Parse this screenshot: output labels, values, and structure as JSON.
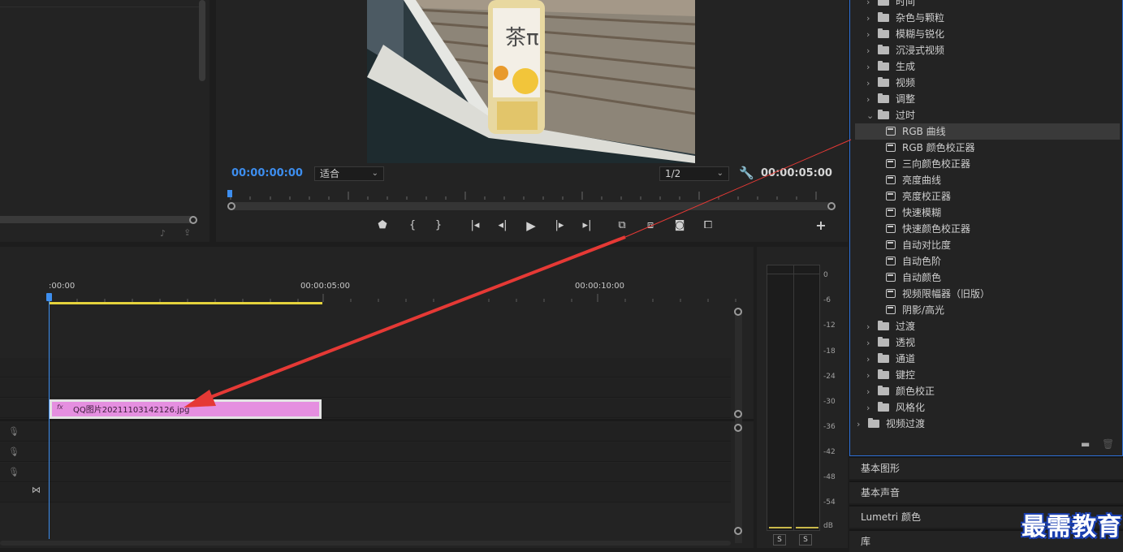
{
  "monitor": {
    "timecode_current": "00:00:00:00",
    "timecode_duration": "00:00:05:00",
    "fit_select": "适合",
    "resolution_select": "1/2",
    "video_label_text": "茶π"
  },
  "timeline": {
    "ruler_labels": [
      ":00:00",
      "00:00:05:00",
      "00:00:10:00"
    ],
    "clip": {
      "name": "QQ图片20211103142126.jpg",
      "badge": "fx"
    }
  },
  "meter": {
    "labels": [
      "0",
      "-6",
      "-12",
      "-18",
      "-24",
      "-30",
      "-36",
      "-42",
      "-48",
      "-54",
      "dB"
    ],
    "solo_buttons": [
      "S",
      "S"
    ]
  },
  "effects": {
    "tree": [
      {
        "label": "时间",
        "type": "folder",
        "level": 1,
        "expanded": false
      },
      {
        "label": "杂色与颗粒",
        "type": "folder",
        "level": 1,
        "expanded": false
      },
      {
        "label": "模糊与锐化",
        "type": "folder",
        "level": 1,
        "expanded": false
      },
      {
        "label": "沉浸式视频",
        "type": "folder",
        "level": 1,
        "expanded": false
      },
      {
        "label": "生成",
        "type": "folder",
        "level": 1,
        "expanded": false
      },
      {
        "label": "视频",
        "type": "folder",
        "level": 1,
        "expanded": false
      },
      {
        "label": "调整",
        "type": "folder",
        "level": 1,
        "expanded": false
      },
      {
        "label": "过时",
        "type": "folder",
        "level": 1,
        "expanded": true
      },
      {
        "label": "RGB 曲线",
        "type": "effect",
        "level": 2,
        "selected": true
      },
      {
        "label": "RGB 颜色校正器",
        "type": "effect",
        "level": 2
      },
      {
        "label": "三向颜色校正器",
        "type": "effect",
        "level": 2
      },
      {
        "label": "亮度曲线",
        "type": "effect",
        "level": 2
      },
      {
        "label": "亮度校正器",
        "type": "effect",
        "level": 2
      },
      {
        "label": "快速模糊",
        "type": "effect",
        "level": 2
      },
      {
        "label": "快速颜色校正器",
        "type": "effect",
        "level": 2
      },
      {
        "label": "自动对比度",
        "type": "effect",
        "level": 2
      },
      {
        "label": "自动色阶",
        "type": "effect",
        "level": 2
      },
      {
        "label": "自动颜色",
        "type": "effect",
        "level": 2
      },
      {
        "label": "视频限幅器（旧版）",
        "type": "effect",
        "level": 2
      },
      {
        "label": "阴影/高光",
        "type": "effect",
        "level": 2
      },
      {
        "label": "过渡",
        "type": "folder",
        "level": 1,
        "expanded": false
      },
      {
        "label": "透视",
        "type": "folder",
        "level": 1,
        "expanded": false
      },
      {
        "label": "通道",
        "type": "folder",
        "level": 1,
        "expanded": false
      },
      {
        "label": "键控",
        "type": "folder",
        "level": 1,
        "expanded": false
      },
      {
        "label": "颜色校正",
        "type": "folder",
        "level": 1,
        "expanded": false
      },
      {
        "label": "风格化",
        "type": "folder",
        "level": 1,
        "expanded": false
      },
      {
        "label": "视频过渡",
        "type": "folder",
        "level": 0,
        "expanded": false
      }
    ]
  },
  "side_panels": [
    "基本图形",
    "基本声音",
    "Lumetri 颜色",
    "库"
  ],
  "watermark": "最需教育",
  "colors": {
    "accent": "#3d8eef",
    "clip": "#e58fe0",
    "arrow": "#e53935",
    "workarea": "#e4d23c"
  }
}
